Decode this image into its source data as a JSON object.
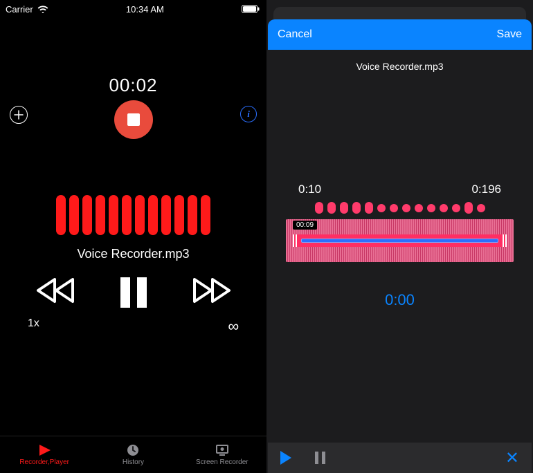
{
  "left": {
    "status": {
      "carrier": "Carrier",
      "time": "10:34 AM"
    },
    "timer": "00:02",
    "filename": "Voice Recorder.mp3",
    "speed": "1x",
    "loop": "∞",
    "tabs": {
      "recorder": "Recorder,Player",
      "history": "History",
      "screen": "Screen Recorder"
    }
  },
  "right": {
    "cancel": "Cancel",
    "save": "Save",
    "filename": "Voice Recorder.mp3",
    "range_start": "0:10",
    "range_end": "0:196",
    "tooltip": "00:09",
    "playtime": "0:00"
  }
}
